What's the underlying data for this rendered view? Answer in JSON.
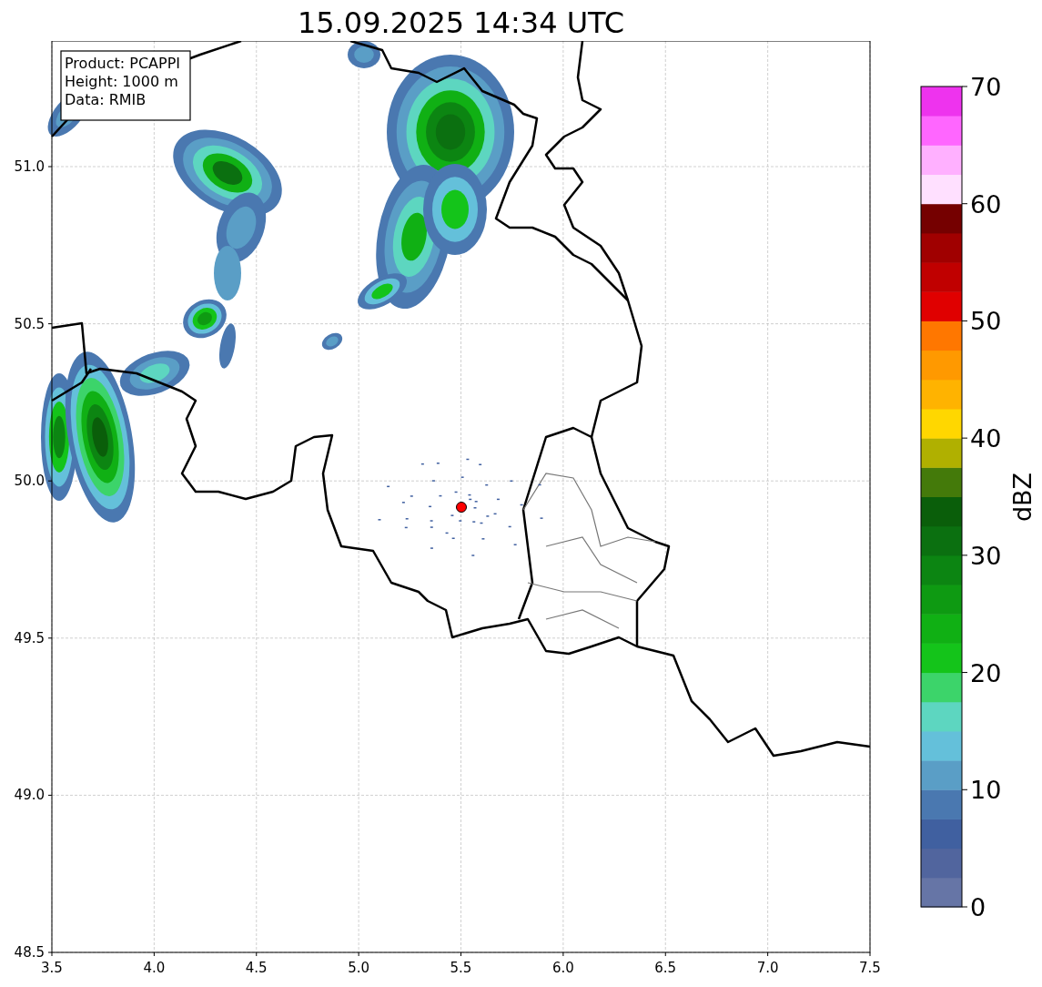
{
  "title": "15.09.2025 14:34 UTC",
  "info_box": [
    "Product: PCAPPI",
    "Height: 1000 m",
    "Data: RMIB"
  ],
  "map": {
    "x_tick_labels": [
      "3.5",
      "4.0",
      "4.5",
      "5.0",
      "5.5",
      "6.0",
      "6.5",
      "7.0",
      "7.5"
    ],
    "y_tick_labels": [
      "51.0",
      "50.5",
      "50.0",
      "49.5",
      "49.0",
      "48.5"
    ]
  },
  "colorbar": {
    "label": "dBZ",
    "tick_labels": [
      "70",
      "60",
      "50",
      "40",
      "30",
      "20",
      "10",
      "0"
    ],
    "bins": [
      {
        "color": "#6675a6"
      },
      {
        "color": "#51659e"
      },
      {
        "color": "#4060a0"
      },
      {
        "color": "#4a78b0"
      },
      {
        "color": "#5a9ec6"
      },
      {
        "color": "#64c0da"
      },
      {
        "color": "#5dd6c0"
      },
      {
        "color": "#3cd46a"
      },
      {
        "color": "#14c41a"
      },
      {
        "color": "#10b014"
      },
      {
        "color": "#0e9a12"
      },
      {
        "color": "#0c8512"
      },
      {
        "color": "#0b7010"
      },
      {
        "color": "#0a5e0a"
      },
      {
        "color": "#447a0a"
      },
      {
        "color": "#b0b000"
      },
      {
        "color": "#ffd700"
      },
      {
        "color": "#ffb300"
      },
      {
        "color": "#ff9900"
      },
      {
        "color": "#ff7700"
      },
      {
        "color": "#e00000"
      },
      {
        "color": "#c00000"
      },
      {
        "color": "#a00000"
      },
      {
        "color": "#750000"
      },
      {
        "color": "#ffe0ff"
      },
      {
        "color": "#ffb0ff"
      },
      {
        "color": "#ff66ff"
      },
      {
        "color": "#ee33ee"
      }
    ]
  }
}
